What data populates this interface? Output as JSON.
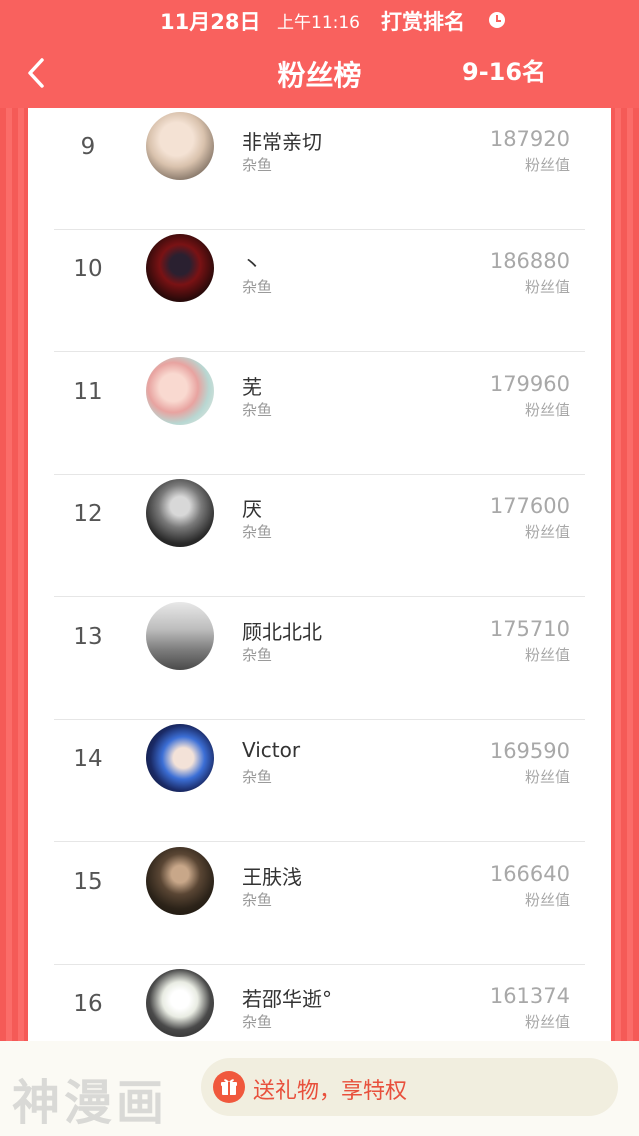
{
  "status_bar": {
    "date": "11月28日",
    "time": "上午11:16",
    "title": "打赏排名"
  },
  "nav": {
    "title": "粉丝榜",
    "range": "9-16名"
  },
  "rows": [
    {
      "rank": "9",
      "name": "非常亲切",
      "tag": "杂鱼",
      "value": "187920",
      "unit": "粉丝值",
      "avatar": "anime-girl-pale"
    },
    {
      "rank": "10",
      "name": "丶",
      "tag": "杂鱼",
      "value": "186880",
      "unit": "粉丝值",
      "avatar": "joker-dark-red"
    },
    {
      "rank": "11",
      "name": "芜",
      "tag": "杂鱼",
      "value": "179960",
      "unit": "粉丝值",
      "avatar": "anime-pastel"
    },
    {
      "rank": "12",
      "name": "厌",
      "tag": "杂鱼",
      "value": "177600",
      "unit": "粉丝值",
      "avatar": "bw-portrait"
    },
    {
      "rank": "13",
      "name": "顾北北北",
      "tag": "杂鱼",
      "value": "175710",
      "unit": "粉丝值",
      "avatar": "bw-street"
    },
    {
      "rank": "14",
      "name": "Victor",
      "tag": "杂鱼",
      "value": "169590",
      "unit": "粉丝值",
      "avatar": "anime-blue-hair"
    },
    {
      "rank": "15",
      "name": "王肤浅",
      "tag": "杂鱼",
      "value": "166640",
      "unit": "粉丝值",
      "avatar": "costume-portrait"
    },
    {
      "rank": "16",
      "name": "若邵华逝°",
      "tag": "杂鱼",
      "value": "161374",
      "unit": "粉丝值",
      "avatar": "chibi-maid"
    }
  ],
  "footer": {
    "logo": "神漫画",
    "gift_button": "送礼物，享特权",
    "gift_icon": "gift-icon"
  },
  "colors": {
    "header": "#f9615e",
    "accent": "#e8503c"
  }
}
